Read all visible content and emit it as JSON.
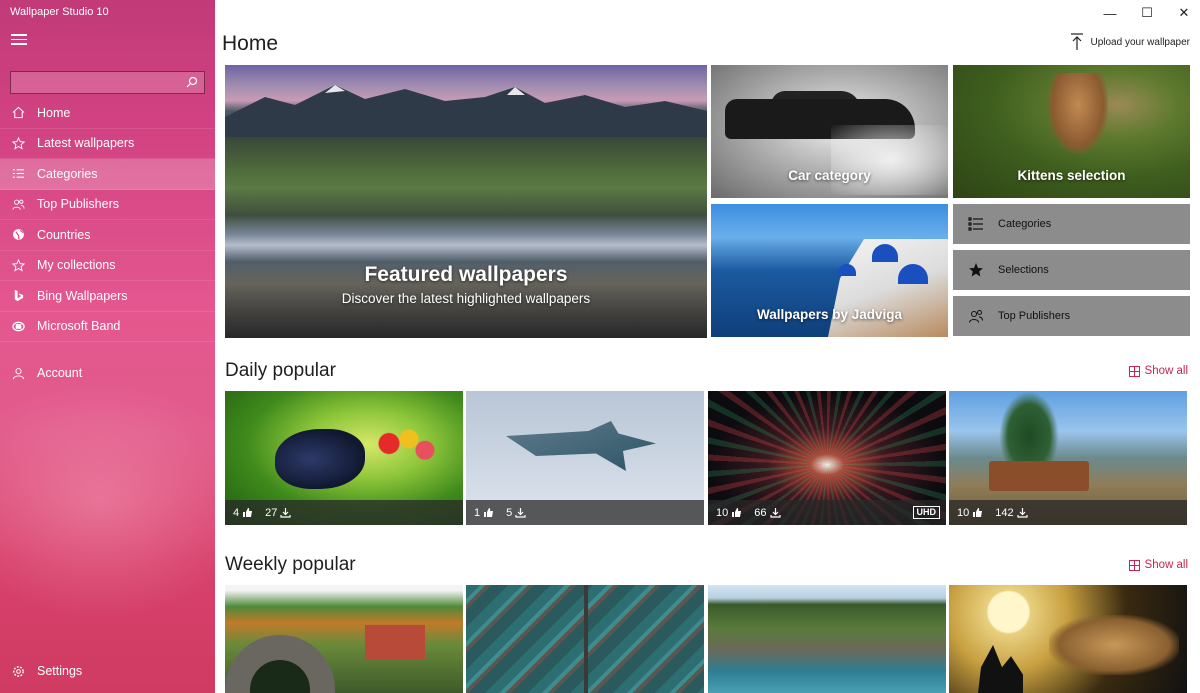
{
  "window": {
    "title": "Wallpaper Studio 10",
    "controls": {
      "minimize": "—",
      "maximize": "☐",
      "close": "✕"
    }
  },
  "sidebar": {
    "search": {
      "value": "",
      "placeholder": ""
    },
    "items": [
      {
        "label": "Home",
        "icon": "home-icon",
        "active": false
      },
      {
        "label": "Latest wallpapers",
        "icon": "star-outline-icon",
        "active": false
      },
      {
        "label": "Categories",
        "icon": "list-icon",
        "active": true
      },
      {
        "label": "Top Publishers",
        "icon": "people-icon",
        "active": false
      },
      {
        "label": "Countries",
        "icon": "globe-icon",
        "active": false
      },
      {
        "label": "My collections",
        "icon": "star-outline-icon",
        "active": false
      },
      {
        "label": "Bing Wallpapers",
        "icon": "bing-icon",
        "active": false
      },
      {
        "label": "Microsoft Band",
        "icon": "band-icon",
        "active": false
      }
    ],
    "account": {
      "label": "Account",
      "icon": "person-icon"
    },
    "settings": {
      "label": "Settings",
      "icon": "gear-icon"
    }
  },
  "header": {
    "title": "Home",
    "upload_label": "Upload your wallpaper"
  },
  "hero": {
    "featured_title": "Featured wallpapers",
    "featured_subtitle": "Discover the latest highlighted wallpapers",
    "car_title": "Car category",
    "kittens_title": "Kittens selection",
    "jadviga_title": "Wallpapers by Jadviga",
    "buttons": [
      {
        "label": "Categories",
        "icon": "list-icon"
      },
      {
        "label": "Selections",
        "icon": "star-filled-icon"
      },
      {
        "label": "Top Publishers",
        "icon": "people-icon"
      }
    ]
  },
  "daily": {
    "title": "Daily popular",
    "show_all": "Show all",
    "cards": [
      {
        "likes": "4",
        "downloads": "27",
        "badge": ""
      },
      {
        "likes": "1",
        "downloads": "5",
        "badge": ""
      },
      {
        "likes": "10",
        "downloads": "66",
        "badge": "UHD"
      },
      {
        "likes": "10",
        "downloads": "142",
        "badge": ""
      }
    ]
  },
  "weekly": {
    "title": "Weekly popular",
    "show_all": "Show all"
  },
  "colors": {
    "accent": "#c8254e",
    "sidebar_top": "#c23a78",
    "sidebar_bottom": "#cf3b63",
    "tile_gray": "#8c8c8c"
  }
}
